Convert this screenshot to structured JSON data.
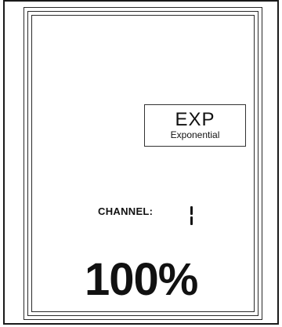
{
  "display": {
    "mode": {
      "abbrev": "EXP",
      "name": "Exponential"
    },
    "channel": {
      "label": "CHANNEL:",
      "value": "1"
    },
    "percent": "100%"
  }
}
